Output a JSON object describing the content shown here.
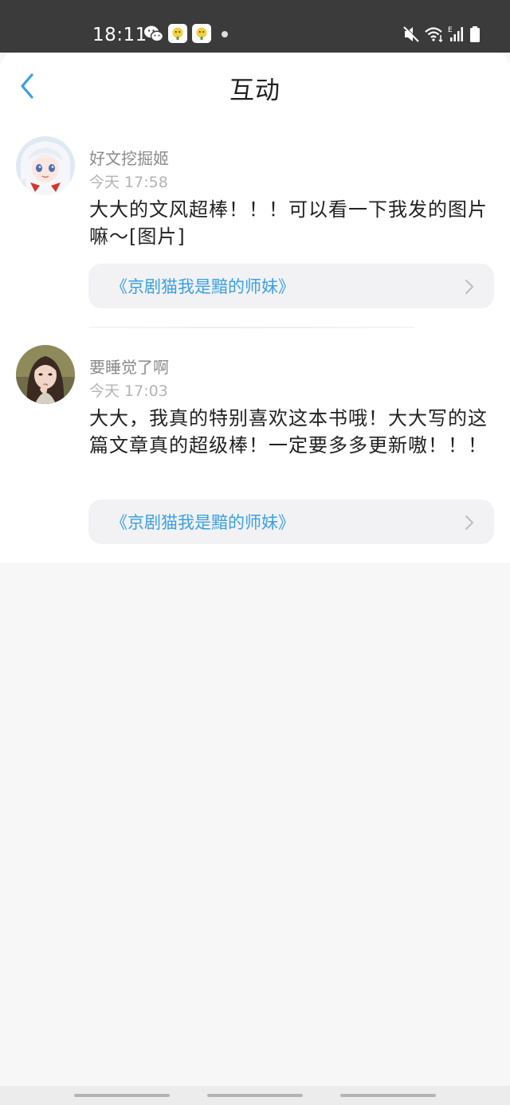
{
  "status_bar": {
    "time": "18:11",
    "icons": [
      "wechat-icon",
      "app-icon",
      "app-icon",
      "dot-icon",
      "mute-icon",
      "wifi-icon",
      "signal-icon",
      "battery-icon"
    ],
    "background": "#3b3b3b"
  },
  "header": {
    "title": "互动",
    "back_icon": "chevron-left-icon",
    "accent": "#3aa0e4"
  },
  "comments": [
    {
      "username": "好文挖掘姬",
      "time": "今天 17:58",
      "message": "大大的文风超棒！！！可以看一下我发的图片嘛～[图片]",
      "book": "《京剧猫我是黯的师妹》"
    },
    {
      "username": "要睡觉了啊",
      "time": "今天 17:03",
      "message": "大大，我真的特别喜欢这本书哦！大大写的这篇文章真的超级棒！一定要多多更新嗷！！！",
      "book": "《京剧猫我是黯的师妹》"
    }
  ]
}
